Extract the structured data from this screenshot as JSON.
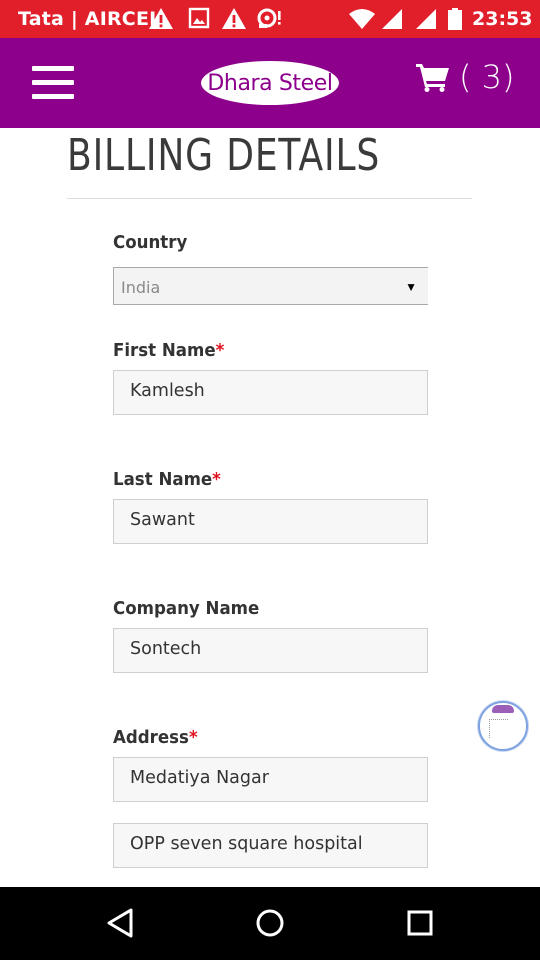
{
  "status_bar": {
    "carrier": "Tata | AIRCEL",
    "time": "23:53",
    "left_icons": [
      "warning-icon",
      "image-icon",
      "warning-icon",
      "sync-alert-icon"
    ],
    "right_icons": [
      "wifi-icon",
      "signal-icon",
      "signal-icon",
      "battery-icon"
    ]
  },
  "header": {
    "brand": "Dhara Steel",
    "cart_count": "( 3)",
    "background": "#8c008c"
  },
  "page": {
    "title": "BILLING DETAILS"
  },
  "form": {
    "country": {
      "label": "Country",
      "value": "India"
    },
    "first_name": {
      "label": "First Name",
      "required": "*",
      "value": "Kamlesh"
    },
    "last_name": {
      "label": "Last Name",
      "required": "*",
      "value": "Sawant"
    },
    "company": {
      "label": "Company Name",
      "value": "Sontech"
    },
    "address": {
      "label": "Address",
      "required": "*",
      "line1": "Medatiya Nagar",
      "line2": "OPP seven square hospital"
    }
  },
  "nav": {
    "icons": [
      "back-icon",
      "home-icon",
      "recents-icon"
    ]
  }
}
